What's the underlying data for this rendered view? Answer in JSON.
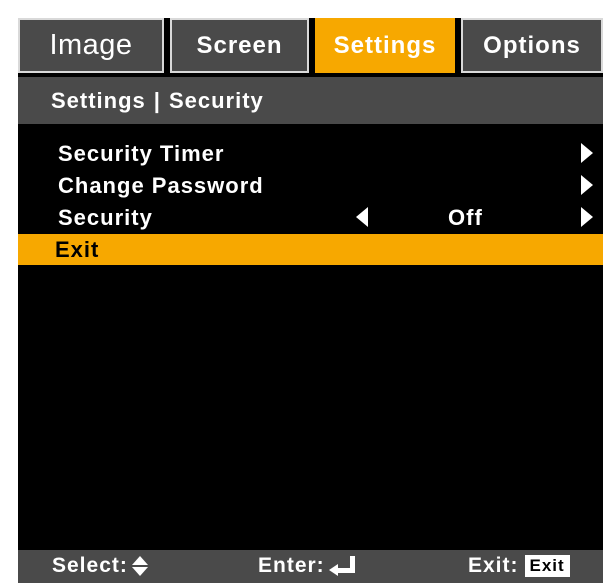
{
  "tabs": [
    {
      "label": "Image"
    },
    {
      "label": "Screen"
    },
    {
      "label": "Settings",
      "active": true
    },
    {
      "label": "Options"
    }
  ],
  "breadcrumb": {
    "section": "Settings",
    "separator": "|",
    "page": "Security"
  },
  "menu": {
    "items": [
      {
        "label": "Security Timer"
      },
      {
        "label": "Change Password"
      },
      {
        "label": "Security",
        "value": "Off"
      },
      {
        "label": "Exit",
        "selected": true
      }
    ]
  },
  "footer": {
    "select_label": "Select:",
    "enter_label": "Enter:",
    "exit_label": "Exit:",
    "exit_key": "Exit"
  },
  "colors": {
    "accent": "#f7a800",
    "panel": "#4a4a4a",
    "background": "#000000"
  }
}
